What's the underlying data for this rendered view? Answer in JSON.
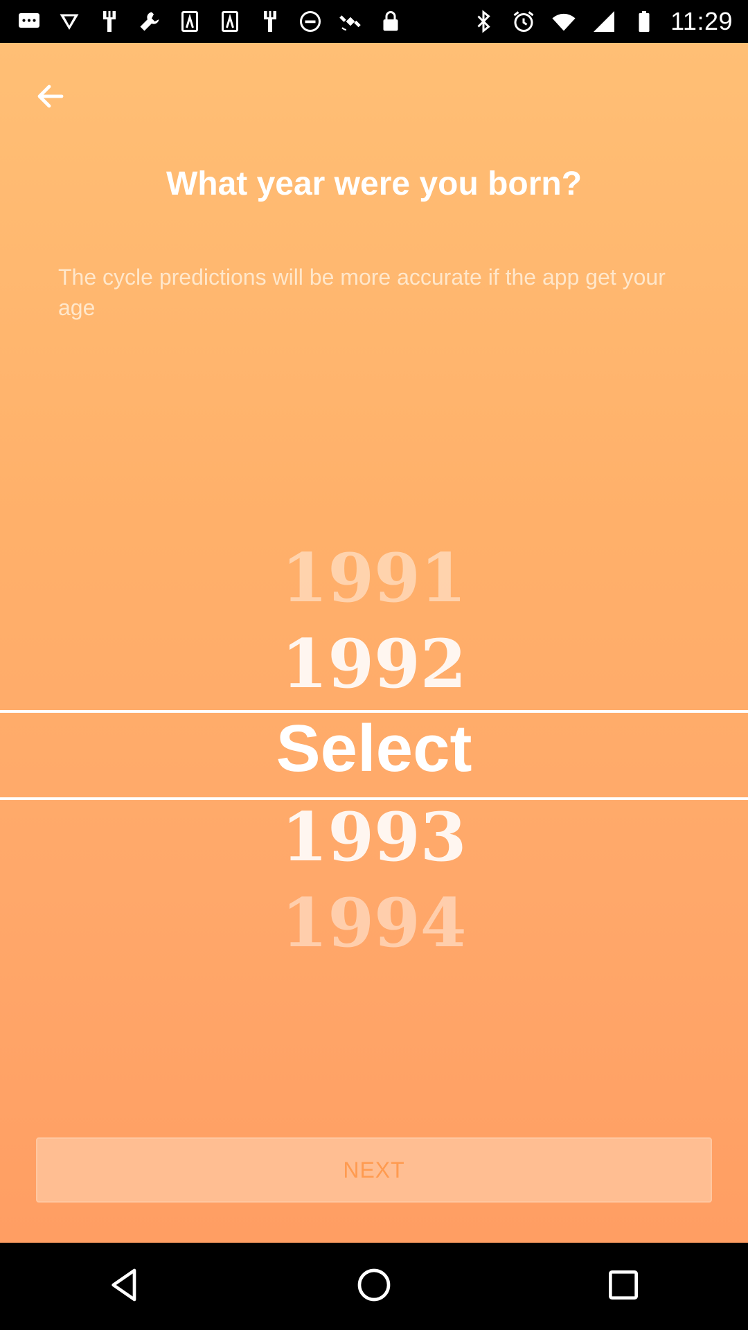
{
  "status_bar": {
    "time": "11:29",
    "left_icons": [
      "message-icon",
      "download-icon",
      "tool-icon",
      "wrench-icon",
      "signal-tower-icon",
      "signal-tower-icon",
      "tool-icon",
      "dnd-icon",
      "satellite-icon",
      "lock-icon"
    ],
    "right_icons": [
      "bluetooth-icon",
      "alarm-icon",
      "wifi-icon",
      "cell-signal-icon",
      "battery-icon"
    ]
  },
  "header": {
    "back_icon": "arrow-left-icon",
    "title": "What year were you born?",
    "subtitle": "The cycle predictions will be more accurate if the app get your age"
  },
  "picker": {
    "items": [
      "1991",
      "1992",
      "Select",
      "1993",
      "1994"
    ],
    "selected": "Select"
  },
  "footer": {
    "next_label": "NEXT"
  },
  "nav_bar": {
    "icons": [
      "back-triangle-icon",
      "home-circle-icon",
      "recents-square-icon"
    ]
  },
  "colors": {
    "gradient_top": "#ffbf75",
    "gradient_bottom": "#ff9e63",
    "next_button_bg": "#ffbe92",
    "next_button_text": "#ff9b50"
  }
}
